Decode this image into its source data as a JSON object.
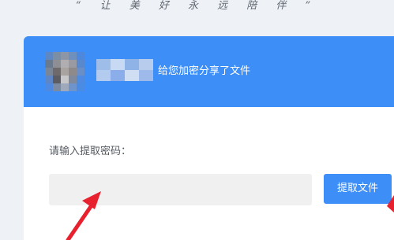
{
  "slogan": "“ 让 美 好 永 远 陪 伴 ”",
  "header": {
    "share_message": "给您加密分享了文件",
    "sharer_name_blurred": true,
    "avatar_blurred": true
  },
  "form": {
    "password_label": "请输入提取密码：",
    "password_value": "",
    "extract_button_label": "提取文件"
  },
  "colors": {
    "header_bg": "#3e8ef7",
    "button_bg": "#3e8ef7",
    "annotation_arrow": "#e8212e",
    "page_bg": "#eef1f5"
  }
}
